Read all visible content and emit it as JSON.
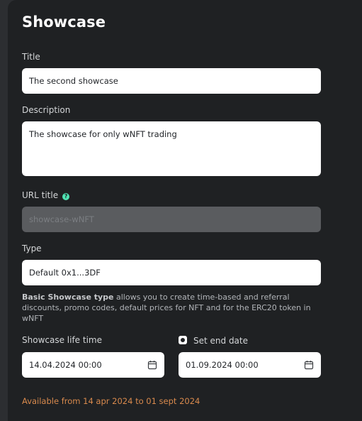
{
  "page_title": "Showcase",
  "title_field": {
    "label": "Title",
    "value": "The second showcase"
  },
  "description_field": {
    "label": "Description",
    "value": "The showcase for only wNFT trading"
  },
  "url_title_field": {
    "label": "URL title",
    "placeholder": "showcase-wNFT",
    "help_icon_glyph": "?"
  },
  "type_field": {
    "label": "Type",
    "value": "Default 0x1...3DF",
    "description_bold": "Basic Showcase type",
    "description_rest": " allows you to create time-based and referral discounts, promo codes, default prices for NFT and for the ERC20 token in wNFT"
  },
  "life_time": {
    "label": "Showcase life time",
    "start_value": "14.04.2024 00:00",
    "end_checkbox_label": "Set end date",
    "end_checked": true,
    "end_value": "01.09.2024 00:00",
    "availability_text": "Available from 14 apr 2024 to 01 sept 2024"
  },
  "colors": {
    "panel_background": "#1f2123",
    "page_background": "#2c2e31",
    "help_icon": "#4fe3b3",
    "availability_text": "#d98a4d"
  }
}
